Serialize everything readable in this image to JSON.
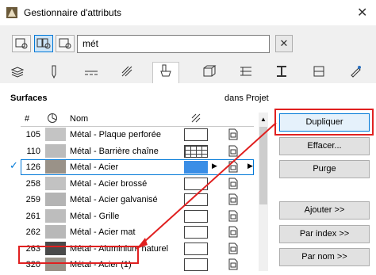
{
  "window": {
    "title": "Gestionnaire d'attributs",
    "close_glyph": "✕"
  },
  "toolbar": {
    "search_value": "mét",
    "clear_glyph": "✕",
    "buttons": [
      {
        "icon": "list-search-icon"
      },
      {
        "icon": "list-search-split-icon"
      },
      {
        "icon": "search-icon"
      }
    ]
  },
  "tabs": [
    {
      "icon": "layers-icon"
    },
    {
      "icon": "pen-icon"
    },
    {
      "icon": "line-type-icon"
    },
    {
      "icon": "fill-icon"
    },
    {
      "icon": "surface-paint-icon"
    },
    {
      "icon": "building-material-icon"
    },
    {
      "icon": "composite-icon"
    },
    {
      "icon": "profile-icon"
    },
    {
      "icon": "zone-icon"
    },
    {
      "icon": "ifc-icon"
    }
  ],
  "section": {
    "title": "Surfaces",
    "projet": "dans Projet"
  },
  "list": {
    "col_num": "#",
    "col_name": "Nom",
    "rows": [
      {
        "num": "105",
        "name": "Métal - Plaque perforée",
        "color": "#c4c4c4",
        "hatch": "empty"
      },
      {
        "num": "110",
        "name": "Métal - Barrière chaîne",
        "color": "#bcbcbc",
        "hatch": "grid"
      },
      {
        "num": "126",
        "name": "Métal - Acier",
        "color": "#9a9288",
        "hatch": "selected",
        "selected": true,
        "check": "✓"
      },
      {
        "num": "258",
        "name": "Métal - Acier brossé",
        "color": "#c2c2c2",
        "hatch": "empty"
      },
      {
        "num": "259",
        "name": "Métal - Acier galvanisé",
        "color": "#b4b4b4",
        "hatch": "empty"
      },
      {
        "num": "261",
        "name": "Métal - Grille",
        "color": "#bdbdbd",
        "hatch": "empty"
      },
      {
        "num": "262",
        "name": "Métal - Acier mat",
        "color": "#b8b8b8",
        "hatch": "empty"
      },
      {
        "num": "263",
        "name": "Métal - Aluminium naturel",
        "color": "#4a4a4a",
        "hatch": "empty"
      },
      {
        "num": "320",
        "name": "Métal - Acier (1)",
        "color": "#9a9288",
        "hatch": "empty"
      }
    ]
  },
  "buttons": {
    "dupliquer": "Dupliquer",
    "effacer": "Effacer...",
    "purge": "Purge",
    "ajouter": "Ajouter >>",
    "par_index": "Par index >>",
    "par_nom": "Par nom >>"
  },
  "colors": {
    "highlight": "#e02020",
    "selection": "#0078d7"
  }
}
